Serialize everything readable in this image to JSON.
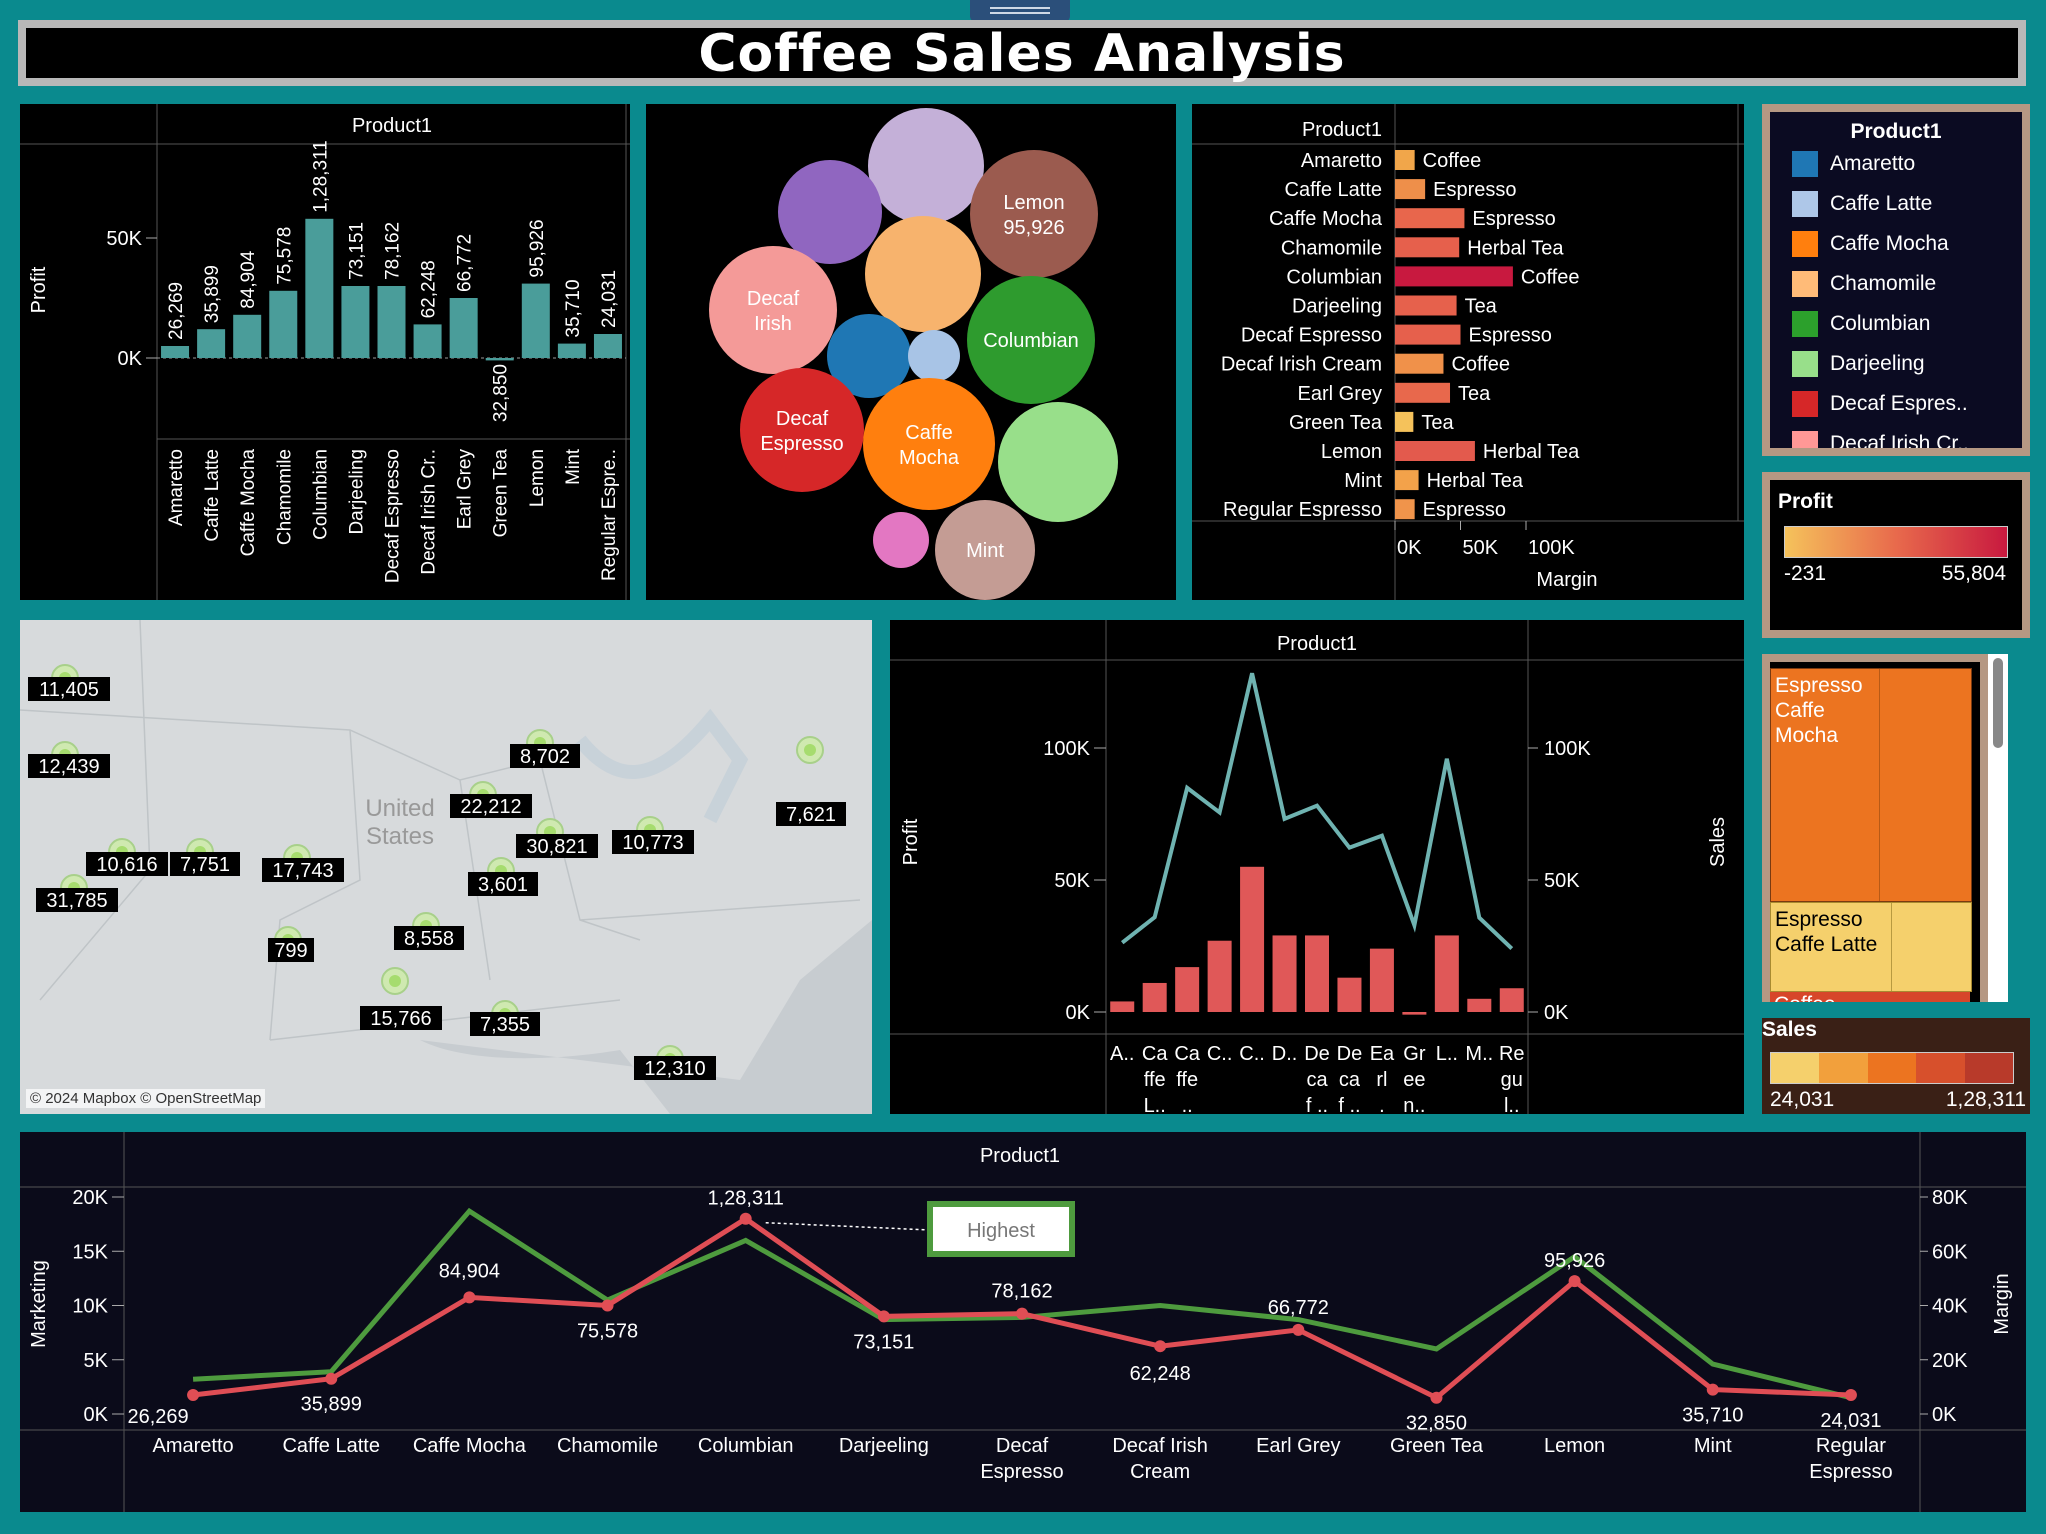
{
  "dashboard": {
    "title": "Coffee Sales Analysis",
    "header_label": "Product1",
    "map_credit": "© 2024 Mapbox © OpenStreetMap",
    "map_region_label": "United\nStates"
  },
  "colors": {
    "teal_bar": "#4a9d9a",
    "red_bar": "#e05858",
    "teal_line": "#6fb3b1",
    "green_line": "#4e9b3e",
    "red_line": "#e04e55",
    "background_teal": "#0a8a8e"
  },
  "chart_data": [
    {
      "id": "profit_bar",
      "type": "bar",
      "title": "Product1",
      "ylabel": "Profit",
      "categories": [
        "Amaretto",
        "Caffe Latte",
        "Caffe Mocha",
        "Chamomile",
        "Columbian",
        "Darjeeling",
        "Decaf Espresso",
        "Decaf Irish Cr..",
        "Earl Grey",
        "Green Tea",
        "Lemon",
        "Mint",
        "Regular Espre.."
      ],
      "values": [
        5000,
        12000,
        18000,
        28000,
        58000,
        30000,
        30000,
        14000,
        25000,
        -1000,
        31000,
        6000,
        10000
      ],
      "data_labels": [
        "26,269",
        "35,899",
        "84,904",
        "75,578",
        "1,28,311",
        "73,151",
        "78,162",
        "62,248",
        "66,772",
        "32,850",
        "95,926",
        "35,710",
        "24,031"
      ],
      "yticks": [
        "50K",
        "0K"
      ],
      "ylim": [
        -10000,
        80000
      ]
    },
    {
      "id": "packed_bubbles",
      "type": "bubble",
      "labels": [
        {
          "name": "",
          "color": "#c4b0d8"
        },
        {
          "name": "Lemon\n95,926",
          "color": "#9b5b4f"
        },
        {
          "name": "",
          "color": "#9066c0"
        },
        {
          "name": "",
          "color": "#f7b36d"
        },
        {
          "name": "Decaf\nIrish",
          "color": "#f49a98"
        },
        {
          "name": "Columbian",
          "color": "#2e9b2e"
        },
        {
          "name": "",
          "color": "#1f77b4"
        },
        {
          "name": "",
          "color": "#a8c4e6"
        },
        {
          "name": "Decaf\nEspresso",
          "color": "#d62728"
        },
        {
          "name": "Caffe\nMocha",
          "color": "#ff7f0e"
        },
        {
          "name": "",
          "color": "#98df8a"
        },
        {
          "name": "",
          "color": "#e377c2"
        },
        {
          "name": "Mint",
          "color": "#c49c94"
        }
      ]
    },
    {
      "id": "margin_bar",
      "type": "bar",
      "title": "Product1",
      "xlabel": "Margin",
      "xticks": [
        "0K",
        "50K",
        "100K"
      ],
      "xlim": [
        0,
        150000
      ],
      "categories": [
        "Amaretto",
        "Caffe Latte",
        "Caffe Mocha",
        "Chamomile",
        "Columbian",
        "Darjeeling",
        "Decaf Espresso",
        "Decaf Irish Cream",
        "Earl Grey",
        "Green Tea",
        "Lemon",
        "Mint",
        "Regular Espresso"
      ],
      "types": [
        "Coffee",
        "Espresso",
        "Espresso",
        "Herbal Tea",
        "Coffee",
        "Tea",
        "Espresso",
        "Coffee",
        "Tea",
        "Tea",
        "Herbal Tea",
        "Herbal Tea",
        "Espresso"
      ],
      "values": [
        15000,
        23000,
        53000,
        49000,
        90000,
        47000,
        50000,
        37000,
        42000,
        14000,
        61000,
        18000,
        15000
      ],
      "colors": [
        "#f1a64a",
        "#ee8f4a",
        "#e8664c",
        "#e6604c",
        "#c8193f",
        "#e6614c",
        "#e6604c",
        "#f0914a",
        "#e8684c",
        "#f5c25b",
        "#e35a4d",
        "#f3a24a",
        "#f0944b"
      ]
    },
    {
      "id": "dual_axis",
      "type": "bar",
      "title": "Product1",
      "ylabel": "Profit",
      "y2label": "Sales",
      "yticks": [
        "100K",
        "50K",
        "0K"
      ],
      "y2ticks": [
        "100K",
        "50K",
        "0K"
      ],
      "categories": [
        "Amaretto",
        "Caffe Latte",
        "Caffe Mocha",
        "Chamomile",
        "Columbian",
        "Darjeeling",
        "Decaf Espresso",
        "Decaf Irish Cream",
        "Earl Grey",
        "Green Tea",
        "Lemon",
        "Mint",
        "Regular Espresso"
      ],
      "tick_labels": [
        "A..",
        "Ca\nffe\nL..",
        "Ca\nffe\n..",
        "C..",
        "C..",
        "D..",
        "De\nca\nf ..",
        "De\nca\nf ..",
        "Ea\nrl\n.",
        "Gr\nee\nn..",
        "L..",
        "M..",
        "Re\ngu\nl.."
      ],
      "profit": [
        4000,
        11000,
        17000,
        27000,
        55000,
        29000,
        29000,
        13000,
        24000,
        -1000,
        29000,
        5000,
        9000
      ],
      "sales": [
        26269,
        35899,
        84904,
        75578,
        128311,
        73151,
        78162,
        62248,
        66772,
        32850,
        95926,
        35710,
        24031
      ],
      "ylim": [
        0,
        130000
      ]
    },
    {
      "id": "marketing_margin",
      "type": "line",
      "title": "Product1",
      "ylabel": "Marketing",
      "y2label": "Margin",
      "yticks": [
        "20K",
        "15K",
        "10K",
        "5K",
        "0K"
      ],
      "y2ticks": [
        "80K",
        "60K",
        "40K",
        "20K",
        "0K"
      ],
      "categories": [
        "Amaretto",
        "Caffe Latte",
        "Caffe Mocha",
        "Chamomile",
        "Columbian",
        "Darjeeling",
        "Decaf\nEspresso",
        "Decaf Irish\nCream",
        "Earl Grey",
        "Green Tea",
        "Lemon",
        "Mint",
        "Regular\nEspresso"
      ],
      "series": [
        {
          "name": "Marketing",
          "values": [
            3200,
            3900,
            18700,
            10500,
            16000,
            8700,
            8900,
            10000,
            8700,
            6000,
            14500,
            4600,
            1500
          ]
        },
        {
          "name": "Margin",
          "values": [
            7000,
            13000,
            43000,
            40000,
            72000,
            36000,
            37000,
            25000,
            31000,
            6000,
            49000,
            9000,
            7000
          ]
        }
      ],
      "data_labels": [
        "26,269",
        "35,899",
        "84,904",
        "75,578",
        "1,28,311",
        "73,151",
        "78,162",
        "62,248",
        "66,772",
        "32,850",
        "95,926",
        "35,710",
        "24,031"
      ],
      "annotation": "Highest"
    }
  ],
  "legend": {
    "title": "Product1",
    "items": [
      {
        "label": "Amaretto",
        "color": "#1f77b4"
      },
      {
        "label": "Caffe Latte",
        "color": "#aec7e8"
      },
      {
        "label": "Caffe Mocha",
        "color": "#ff7f0e"
      },
      {
        "label": "Chamomile",
        "color": "#ffbb78"
      },
      {
        "label": "Columbian",
        "color": "#2ca02c"
      },
      {
        "label": "Darjeeling",
        "color": "#98df8a"
      },
      {
        "label": "Decaf Espres..",
        "color": "#d62728"
      },
      {
        "label": "Decaf Irish Cr..",
        "color": "#ff9896"
      }
    ]
  },
  "profit_legend": {
    "title": "Profit",
    "min": "-231",
    "max": "55,804"
  },
  "sales_legend": {
    "title": "Sales",
    "min": "24,031",
    "max": "1,28,311"
  },
  "treemap": [
    {
      "label": "Espresso\nCaffe\nMocha",
      "color": "#ec7420"
    },
    {
      "label": "Espresso\nCaffe Latte",
      "color": "#f5d06c"
    },
    {
      "label": "Coffee",
      "color": "#d7462a"
    }
  ],
  "map_points": [
    {
      "label": "11,405"
    },
    {
      "label": "12,439"
    },
    {
      "label": "10,616"
    },
    {
      "label": "7,751"
    },
    {
      "label": "31,785"
    },
    {
      "label": "17,743"
    },
    {
      "label": "799"
    },
    {
      "label": "8,702"
    },
    {
      "label": "22,212"
    },
    {
      "label": "30,821"
    },
    {
      "label": "3,601"
    },
    {
      "label": "8,558"
    },
    {
      "label": "15,766"
    },
    {
      "label": "7,355"
    },
    {
      "label": "10,773"
    },
    {
      "label": "7,621"
    },
    {
      "label": "12,310"
    }
  ]
}
